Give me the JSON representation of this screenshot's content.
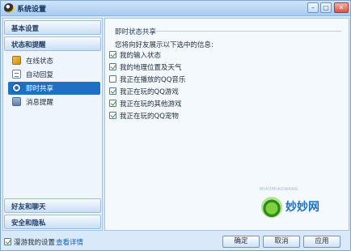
{
  "window": {
    "title": "系统设置",
    "controls": {
      "minimize": "–",
      "maximize": "□",
      "close": "✕"
    }
  },
  "nav": {
    "headers": [
      {
        "id": "basic",
        "label": "基本设置"
      },
      {
        "id": "status",
        "label": "状态和提醒"
      },
      {
        "id": "chat",
        "label": "好友和聊天"
      },
      {
        "id": "security",
        "label": "安全和隐私"
      }
    ],
    "items": [
      {
        "label": "在线状态",
        "icon": "online-status-icon"
      },
      {
        "label": "自动回复",
        "icon": "auto-reply-icon"
      },
      {
        "label": "即时共享",
        "icon": "instant-share-icon",
        "selected": true
      },
      {
        "label": "消息提醒",
        "icon": "message-alert-icon"
      }
    ]
  },
  "panel": {
    "section_title": "即时状态共享",
    "intro": "您将向好友展示以下选中的信息:",
    "options": [
      {
        "label": "我的输入状态",
        "checked": true
      },
      {
        "label": "我的地理位置及天气",
        "checked": true
      },
      {
        "label": "我正在播放的QQ音乐",
        "checked": false
      },
      {
        "label": "我正在玩的QQ游戏",
        "checked": true
      },
      {
        "label": "我正在玩的其他游戏",
        "checked": true
      },
      {
        "label": "我正在玩的QQ宠物",
        "checked": true
      }
    ]
  },
  "watermark": {
    "small": "MIAOMIAOWANG",
    "text": "妙妙网"
  },
  "bottom": {
    "roam_label": "漫游我的设置",
    "roam_checked": true,
    "details_link": "查看详情",
    "ok": "确定",
    "cancel": "取消",
    "apply": "应用"
  }
}
